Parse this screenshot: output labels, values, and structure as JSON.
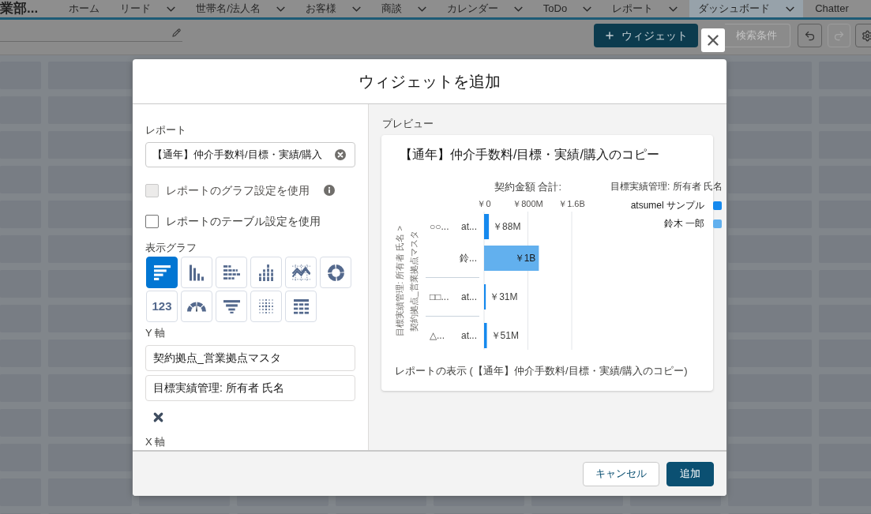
{
  "app_name": "業部...",
  "nav": [
    {
      "label": "ホーム",
      "dropdown": false,
      "selected": false
    },
    {
      "label": "リード",
      "dropdown": true,
      "selected": false
    },
    {
      "label": "世帯名/法人名",
      "dropdown": true,
      "selected": false
    },
    {
      "label": "お客様",
      "dropdown": true,
      "selected": false
    },
    {
      "label": "商談",
      "dropdown": true,
      "selected": false
    },
    {
      "label": "カレンダー",
      "dropdown": true,
      "selected": false
    },
    {
      "label": "ToDo",
      "dropdown": true,
      "selected": false
    },
    {
      "label": "レポート",
      "dropdown": true,
      "selected": false
    },
    {
      "label": "ダッシュボード",
      "dropdown": true,
      "selected": true
    },
    {
      "label": "Chatter",
      "dropdown": false,
      "selected": false
    }
  ],
  "toolbar": {
    "add_widget_button": "ウィジェット",
    "filter_button": {
      "label": "検索条件",
      "disabled": true
    },
    "history_buttons": [
      {
        "kind": "undo",
        "disabled": false
      },
      {
        "kind": "redo",
        "disabled": true
      }
    ]
  },
  "dialog": {
    "title": "ウィジェットを追加",
    "report": {
      "label": "レポート",
      "value": "【通年】仲介手数料/目標・実績/購入"
    },
    "options": [
      {
        "label": "レポートのグラフ設定を使用",
        "checked": false,
        "disabled": true,
        "info": true
      },
      {
        "label": "レポートのテーブル設定を使用",
        "checked": false,
        "disabled": false,
        "info": false
      }
    ],
    "chart_types_label": "表示グラフ",
    "chart_types": [
      {
        "kind": "horizontal-bar",
        "selected": true
      },
      {
        "kind": "vertical-bar",
        "selected": false
      },
      {
        "kind": "stacked-horizontal-bar",
        "selected": false
      },
      {
        "kind": "stacked-vertical-bar",
        "selected": false
      },
      {
        "kind": "line",
        "selected": false
      },
      {
        "kind": "donut",
        "selected": false
      },
      {
        "kind": "metric",
        "label": "123",
        "selected": false
      },
      {
        "kind": "gauge",
        "selected": false
      },
      {
        "kind": "funnel",
        "selected": false
      },
      {
        "kind": "scatter",
        "selected": false
      },
      {
        "kind": "table",
        "selected": false
      }
    ],
    "y_axis_label": "Y 軸",
    "y_axis_fields": [
      "契約拠点_営業拠点マスタ",
      "目標実績管理: 所有者 氏名"
    ],
    "next_section_label": "X 軸",
    "preview": {
      "label": "プレビュー",
      "title": "【通年】仲介手数料/目標・実績/購入のコピー",
      "chart_data": {
        "type": "bar",
        "orientation": "horizontal",
        "xlabel": "契約金額 合計:",
        "ylabel": [
          "目標実績管理: 所有者 氏名 >",
          "契約拠点_営業拠点マスタ"
        ],
        "categories": [
          {
            "group": "○○...",
            "label": "at...",
            "color": "#1589ee"
          },
          {
            "label": "鈴...",
            "color": "#62b0ee"
          },
          {
            "group": "□□...",
            "label": "at...",
            "color": "#1589ee"
          },
          {
            "group": "△...",
            "label": "at...",
            "color": "#1589ee"
          }
        ],
        "values": [
          88000000,
          1000000000,
          31000000,
          51000000
        ],
        "xlim": [
          0,
          1600000000
        ],
        "xticks": [
          {
            "value": 0,
            "label": "￥0"
          },
          {
            "value": 800000000,
            "label": "￥800M"
          },
          {
            "value": 1600000000,
            "label": "￥1.6B"
          }
        ],
        "value_labels": [
          "￥88M",
          "￥1B",
          "￥31M",
          "￥51M"
        ]
      },
      "legend": {
        "title": "目標実績管理: 所有者 氏名",
        "items": [
          {
            "name": "atsumel サンプル",
            "color": "#1589ee"
          },
          {
            "name": "鈴木 一郎",
            "color": "#62b0ee"
          }
        ]
      },
      "report_link": "レポートの表示 (【通年】仲介手数料/目標・実績/購入のコピー)"
    },
    "buttons": [
      {
        "kind": "neutral",
        "label": "キャンセル"
      },
      {
        "kind": "brand",
        "label": "追加"
      }
    ]
  }
}
